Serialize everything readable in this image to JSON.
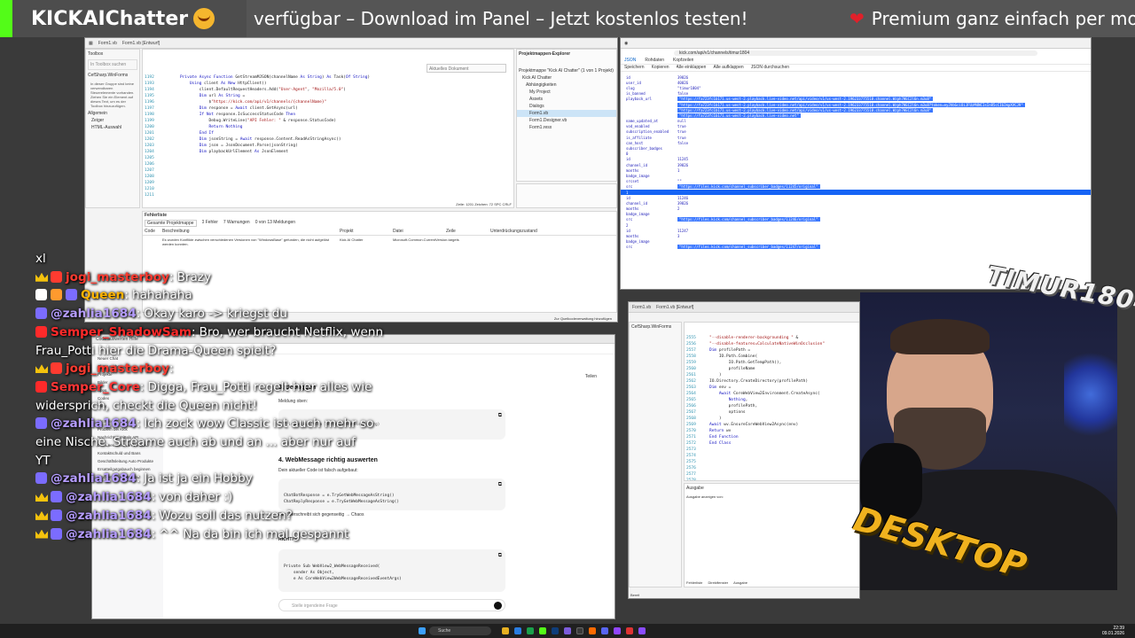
{
  "banner": {
    "brand": "KICKAIChatter",
    "ticker_left": "verfügbar – Download im Panel – Jetzt kostenlos testen!",
    "ticker_right": "Premium ganz einfach per monat"
  },
  "vs": {
    "tabs": [
      "Form1.vb",
      "Form1.vb [Entwurf]"
    ],
    "search_placeholder": "Aktuelles Dokument",
    "toolbox_title": "Toolbox",
    "toolbox_search": "In Toolbox suchen",
    "toolbox_group": "CefSharp.WinForms",
    "toolbox_note": "In dieser Gruppe sind keine verwendbaren Steuerelemente vorhanden. Ziehen Sie ein Element auf dieses Text, um es der Toolbox hinzuzufügen.",
    "toolbox_items": [
      "Allgemein",
      "Zeiger",
      "HTML-Auswahl"
    ],
    "code_lines": [
      "Private Async Function GetStreamMJSON(channelName As String) As Task(Of String)",
      "",
      "    Using client As New HttpClient()",
      "",
      "        client.DefaultRequestHeaders.Add(\"User-Agent\", \"Mozilla/5.0\")",
      "",
      "        Dim url As String =",
      "            $\"https://kick.com/api/v1/channels/{channelName}\"",
      "",
      "        Dim response = Await client.GetAsync(url)",
      "",
      "        If Not response.IsSuccessStatusCode Then",
      "            Debug.WriteLine(\"API Fehler: \" & response.StatusCode)",
      "            Return Nothing",
      "        End If",
      "",
      "        Dim jsonString = Await response.Content.ReadAsStringAsync()",
      "        Dim json = JsonDocument.Parse(jsonString)",
      "",
      "        Dim playbackUrlElement As JsonElement"
    ],
    "line_start": 1192,
    "status": "Zeile: 1201  Zeichen: 72  SPC  CRLF",
    "explorer_title": "Projektmappen-Explorer",
    "explorer_items": [
      "Projektmappe \"Kick AI Chatter\" (1 von 1 Projekt)",
      "Kick AI Chatter",
      "Abhängigkeiten",
      "My Project",
      "Assets",
      "Dialogs",
      "Form1.vb",
      "Form1.Designer.vb",
      "Form1.resx"
    ],
    "error_title": "Fehlerliste",
    "error_filter": "Gesamte Projektmappe",
    "error_counts": [
      "0 Fehler",
      "7 Warnungen",
      "0 von 13 Meldungen"
    ],
    "error_columns": [
      "Code",
      "Beschreibung",
      "Projekt",
      "Datei",
      "Zeile",
      "Unterdrückungszustand"
    ],
    "error_text": "Es wurden Konflikte zwischen verschiedenen Versionen von \"WindowsBase\" gefunden, die nicht aufgelöst werden konnten.",
    "error_project": "Kick AI Chatter",
    "error_file": "Microsoft.Common.CurrentVersion.targets",
    "bottom_status": "Zur Quellcodeverwaltung hinzufügen"
  },
  "json": {
    "url": "kick.com/api/v1/channels/timur1804",
    "tabs": [
      "JSON",
      "Rohdaten",
      "Kopfzeilen"
    ],
    "toolbar": [
      "Speichern",
      "Kopieren",
      "Alle einklappen",
      "Alle aufklappen",
      "JSON durchsuchen"
    ],
    "rows": [
      {
        "k": "id",
        "v": "39826",
        "link": false,
        "sel": false
      },
      {
        "k": "user_id",
        "v": "40026",
        "link": false,
        "sel": false
      },
      {
        "k": "slug",
        "v": "\"timur1804\"",
        "link": false,
        "sel": false
      },
      {
        "k": "is_banned",
        "v": "false",
        "link": false,
        "sel": false
      },
      {
        "k": "playback_url",
        "v": "\"https://fa723fc1b171.us-west-2.playback.live-video.net/api/video/v1/us-west-2.196233775518.channel.Wzph7HEC2l6n.m3u8\"",
        "link": true,
        "sel": false
      },
      {
        "k": "",
        "v": "\"https://fa723fc1b171.us-west-2.playback.live-video.net/api/video/v1/us-west-2.196233775518.channel.Wzph7HEC2l6n.m3u8?token=eyJhbGciOiJFUzM4NCIsInR5cCI6IkpXVCJ9\"",
        "link": true,
        "sel": false
      },
      {
        "k": "",
        "v": "\"https://fa723fc1b171.us-west-2.playback.live-video.net/api/video/v1/us-west-2.196233775518.channel.Wzph7HEC2l6n.m3u8\"",
        "link": true,
        "sel": false
      },
      {
        "k": "",
        "v": "\"https://fa723fc1b171.us-west-2.playback.live-video.net\"",
        "link": true,
        "sel": false
      },
      {
        "k": "name_updated_at",
        "v": "null",
        "link": false,
        "sel": false
      },
      {
        "k": "vod_enabled",
        "v": "true",
        "link": false,
        "sel": false
      },
      {
        "k": "subscription_enabled",
        "v": "true",
        "link": false,
        "sel": false
      },
      {
        "k": "is_affiliate",
        "v": "true",
        "link": false,
        "sel": false
      },
      {
        "k": "can_host",
        "v": "false",
        "link": false,
        "sel": false
      },
      {
        "k": "subscriber_badges",
        "v": "",
        "link": false,
        "sel": false
      },
      {
        "k": "0",
        "v": "",
        "link": false,
        "sel": false
      },
      {
        "k": "id",
        "v": "11245",
        "link": false,
        "sel": false
      },
      {
        "k": "channel_id",
        "v": "39826",
        "link": false,
        "sel": false
      },
      {
        "k": "months",
        "v": "1",
        "link": false,
        "sel": false
      },
      {
        "k": "badge_image",
        "v": "",
        "link": false,
        "sel": false
      },
      {
        "k": "srcset",
        "v": "\"\"",
        "link": false,
        "sel": false
      },
      {
        "k": "src",
        "v": "\"https://files.kick.com/channel_subscriber_badges/11245/original\"",
        "link": true,
        "sel": false
      },
      {
        "k": "1",
        "v": "",
        "link": false,
        "sel": true
      },
      {
        "k": "id",
        "v": "11246",
        "link": false,
        "sel": false
      },
      {
        "k": "channel_id",
        "v": "39826",
        "link": false,
        "sel": false
      },
      {
        "k": "months",
        "v": "2",
        "link": false,
        "sel": false
      },
      {
        "k": "badge_image",
        "v": "",
        "link": false,
        "sel": false
      },
      {
        "k": "src",
        "v": "\"https://files.kick.com/channel_subscriber_badges/11246/original\"",
        "link": true,
        "sel": false
      },
      {
        "k": "2",
        "v": "",
        "link": false,
        "sel": false
      },
      {
        "k": "id",
        "v": "11247",
        "link": false,
        "sel": false
      },
      {
        "k": "months",
        "v": "3",
        "link": false,
        "sel": false
      },
      {
        "k": "badge_image",
        "v": "",
        "link": false,
        "sel": false
      },
      {
        "k": "src",
        "v": "\"https://files.kick.com/channel_subscriber_badges/11247/original\"",
        "link": true,
        "sel": false
      }
    ]
  },
  "chatgpt": {
    "tab": "Code auswerten Hilfe",
    "side_items": [
      "Neuer Chat",
      "Chats suchen",
      "Projekte",
      "Bilder",
      "Apps",
      "Codex",
      "Mehr",
      "Aktuelle",
      "Problem bei Kick",
      "Nachrichten mittels API",
      "Dokumentation von Vorfällen",
      "Kontaktschuld und Bans",
      "Geschäftsleitung Auto Produkte",
      "Ersatteilgutgabauch beginnen",
      "Probleme mit E-Scooter"
    ],
    "heading3": "3. Debuggen",
    "sub_note": "Meldung oben:",
    "code1": "Private Function TestWebViewMessage(Arg)",
    "heading4": "4. WebMessage richtig auswerten",
    "p4": "Dein aktueller Code ist falsch aufgebaut:",
    "code2a": "ChatBotResponse = e.TryGetWebMessageAsString()",
    "code2b": "ChatReplyResponse = e.TryGetWebMessageAsString()",
    "p5": "Der überschreibt sich gegenseitig → Chaos",
    "right_label": "RICHTIG",
    "code3a": "Private Sub WebView2_WebMessageReceived(",
    "code3b": "    sender As Object,",
    "code3c": "    e As CoreWebView2WebMessageReceivedEventArgs)",
    "input_placeholder": "Stelle irgendeine Frage",
    "share_label": "Teilen"
  },
  "vs2": {
    "tabs": [
      "Form1.vb",
      "Form1.vb [Entwurf]"
    ],
    "code_lines": [
      "\"--disable-renderer-backgrounding \" &",
      "\"--disable-features=CalculateNativeWinOcclusion\"",
      "",
      "Dim profilePath =",
      "    IO.Path.Combine(",
      "        IO.Path.GetTempPath(),",
      "        profileName",
      "    )",
      "",
      "IO.Directory.CreateDirectory(profilePath)",
      "",
      "Dim env =",
      "    Await CoreWebView2Environment.CreateAsync(",
      "        Nothing,",
      "        profilePath,",
      "        options",
      "    )",
      "",
      "Await wv.EnsureCoreWebView2Async(env)",
      "",
      "Return wv",
      "",
      "End Function",
      "",
      "End Class"
    ],
    "line_start": 2555,
    "output_title": "Ausgabe",
    "output_source": "Ausgabe anzeigen von:",
    "bottom_tabs": [
      "Fehlerliste",
      "Direktfenster",
      "Ausgabe"
    ],
    "status": "Bereit"
  },
  "webcam": {
    "logo_top": "TIMUR1804",
    "logo_bottom": "DESKTOP"
  },
  "chat": {
    "lines": [
      {
        "type": "text",
        "text": "xl"
      },
      {
        "type": "msg",
        "badge": "crown",
        "icons": [
          "#ff3b30"
        ],
        "user": "jogi_masterboy",
        "ucls": "u-jogi",
        "sep": ":",
        "msg": "Brazy"
      },
      {
        "type": "msg",
        "badge": "",
        "icons": [
          "#ffffff",
          "#ff9a2e",
          "#7b6cff"
        ],
        "user": "Queen",
        "ucls": "u-queen",
        "sep": ":",
        "msg": "hahahaha"
      },
      {
        "type": "msg",
        "badge": "",
        "icons": [
          "#7b6cff"
        ],
        "user": "@zahlia1684",
        "ucls": "u-zahlia",
        "sep": ":",
        "msg": "Okay karo -> kriegst du"
      },
      {
        "type": "msg",
        "badge": "",
        "icons": [
          "#ff2a2a"
        ],
        "user": "Semper_ShadowSam",
        "ucls": "u-semp",
        "sep": ":",
        "msg": "Bro, wer braucht Netflix, wenn"
      },
      {
        "type": "text",
        "text": "Frau_Potti hier die Drama-Queen spielt?"
      },
      {
        "type": "msg",
        "badge": "crown",
        "icons": [
          "#ff3b30"
        ],
        "user": "jogi_masterboy",
        "ucls": "u-jogi",
        "sep": ":",
        "msg": ""
      },
      {
        "type": "msg",
        "badge": "",
        "icons": [
          "#ff2a2a"
        ],
        "user": "Semper_Core",
        "ucls": "u-core",
        "sep": ":",
        "msg": "Digga, Frau_Potti regelt hier alles wie"
      },
      {
        "type": "text",
        "text": "widersprich, checkt die Queen nicht!"
      },
      {
        "type": "msg",
        "badge": "",
        "icons": [
          "#7b6cff"
        ],
        "user": "@zahlia1684",
        "ucls": "u-zahlia",
        "sep": ":",
        "msg": "Ich zock wow Classic ist auch mehr so"
      },
      {
        "type": "text",
        "text": "eine Nische. Streame auch ab und an ... aber nur auf"
      },
      {
        "type": "text",
        "text": "YT"
      },
      {
        "type": "msg",
        "badge": "",
        "icons": [
          "#7b6cff"
        ],
        "user": "@zahlia1684",
        "ucls": "u-zahlia",
        "sep": ":",
        "msg": "Ja ist ja ein Hobby"
      },
      {
        "type": "msg",
        "badge": "crown",
        "icons": [
          "#7b6cff"
        ],
        "user": "@zahlia1684",
        "ucls": "u-zahlia",
        "sep": ":",
        "msg": "von daher :)"
      },
      {
        "type": "msg",
        "badge": "crown",
        "icons": [
          "#7b6cff"
        ],
        "user": "@zahlia1684",
        "ucls": "u-zahlia",
        "sep": ":",
        "msg": "Wozu soll das nutzen?"
      },
      {
        "type": "msg",
        "badge": "crown",
        "icons": [
          "#7b6cff"
        ],
        "user": "@zahlia1684",
        "ucls": "u-zahlia",
        "sep": ":",
        "msg": "^^ Na da bin ich mal gespannt"
      }
    ]
  },
  "taskbar": {
    "search": "Suche",
    "time": "22:39",
    "date": "09.01.2026"
  }
}
